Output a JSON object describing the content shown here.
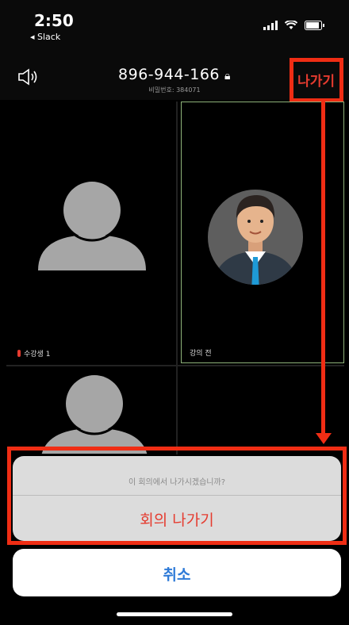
{
  "status": {
    "time": "2:50",
    "back_app": "◂ Slack",
    "icons": [
      "signal-icon",
      "wifi-icon",
      "battery-icon"
    ]
  },
  "header": {
    "meeting_id": "896-944-166",
    "password_line": "비밀번호: 384071",
    "leave_label": "나가기",
    "speaker_icon": "speaker-icon",
    "lock_icon": "lock-icon"
  },
  "participants": [
    {
      "name": "수강생 1",
      "muted": true
    },
    {
      "name": "강의 전",
      "muted": false,
      "active_speaker": true
    },
    {
      "name": "",
      "muted": false
    }
  ],
  "dialog": {
    "message": "이 회의에서 나가시겠습니까?",
    "leave_meeting": "회의 나가기",
    "cancel": "취소"
  },
  "colors": {
    "annotation_red": "#f02d14",
    "leave_red": "#e53b2f",
    "cancel_blue": "#2f7bd8",
    "active_border": "#8fb37a"
  }
}
